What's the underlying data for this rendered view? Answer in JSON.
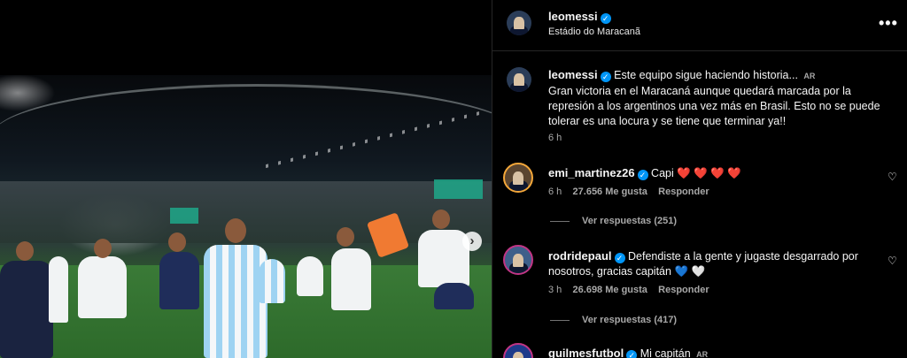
{
  "post": {
    "author": "leomessi",
    "location": "Estádio do Maracanã",
    "more_icon": "more-horizontal-icon",
    "caption": {
      "lead": "Este equipo sigue haciendo historia...",
      "lang_tag": "AR",
      "body": "Gran victoria en el Maracaná aunque quedará marcada por la represión a los argentinos una vez más en Brasil. Esto no se puede tolerar es una locura y se tiene que terminar ya!!",
      "time": "6 h"
    }
  },
  "comments": [
    {
      "user": "emi_martinez26",
      "text": "Capi",
      "emoji": "❤️ ❤️ ❤️ ❤️",
      "time": "6 h",
      "likes": "27.656 Me gusta",
      "reply": "Responder",
      "view_replies": "Ver respuestas (251)"
    },
    {
      "user": "rodridepaul",
      "text": "Defendiste a la gente y jugaste desgarrado por nosotros, gracias capitán",
      "emoji": "💙 🤍",
      "time": "3 h",
      "likes": "26.698 Me gusta",
      "reply": "Responder",
      "view_replies": "Ver respuestas (417)"
    },
    {
      "user": "guilmesfutbol",
      "text": "Mi capitán",
      "lang_tag": "AR"
    }
  ],
  "photo": {
    "next_icon": "chevron-right-icon"
  },
  "colors": {
    "verified": "#0095f6",
    "heart": "#ff3040",
    "background": "#000000"
  }
}
